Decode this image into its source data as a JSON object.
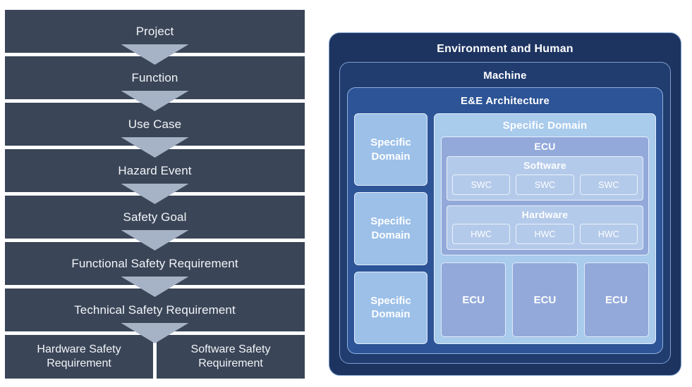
{
  "flow": {
    "steps": [
      {
        "label": "Project"
      },
      {
        "label": "Function"
      },
      {
        "label": "Use Case"
      },
      {
        "label": "Hazard Event"
      },
      {
        "label": "Safety Goal"
      },
      {
        "label": "Functional Safety Requirement"
      },
      {
        "label": "Technical Safety Requirement"
      }
    ],
    "leaves": [
      {
        "line1": "Hardware Safety",
        "line2": "Requirement"
      },
      {
        "line1": "Software Safety",
        "line2": "Requirement"
      }
    ],
    "colors": {
      "box": "#3a4557",
      "arrow": "#a6b2c6",
      "text": "#f2f5f9"
    }
  },
  "architecture": {
    "environment": {
      "title": "Environment and Human",
      "color": "#1d3461"
    },
    "machine": {
      "title": "Machine",
      "color": "#213d70"
    },
    "eea": {
      "title": "E&E Architecture",
      "color": "#2c5496"
    },
    "domain_column": [
      {
        "line1": "Specific",
        "line2": "Domain"
      },
      {
        "line1": "Specific",
        "line2": "Domain"
      },
      {
        "line1": "Specific",
        "line2": "Domain"
      }
    ],
    "domain_main": {
      "title": "Specific Domain",
      "color": "#a9cbec",
      "ecu": {
        "title": "ECU",
        "color": "#93a9da",
        "software": {
          "title": "Software",
          "components": [
            "SWC",
            "SWC",
            "SWC"
          ]
        },
        "hardware": {
          "title": "Hardware",
          "components": [
            "HWC",
            "HWC",
            "HWC"
          ]
        }
      },
      "ecu_row": [
        "ECU",
        "ECU",
        "ECU"
      ]
    }
  }
}
